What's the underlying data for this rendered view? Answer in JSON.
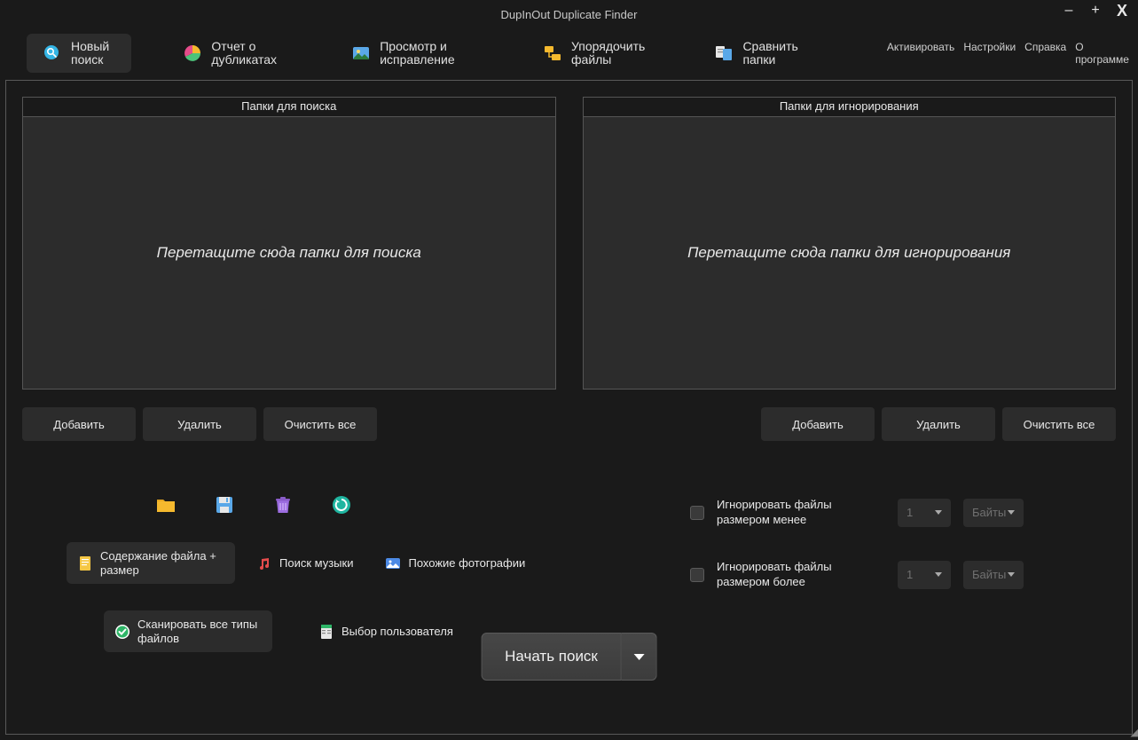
{
  "window": {
    "title": "DupInOut Duplicate Finder",
    "minimize": "–",
    "maximize": "+",
    "close": "X"
  },
  "tabs": {
    "new_search": "Новый поиск",
    "report": "Отчет о дубликатах",
    "review": "Просмотр и исправление",
    "organize": "Упорядочить файлы",
    "compare": "Сравнить папки"
  },
  "menu": {
    "activate": "Активировать",
    "settings": "Настройки",
    "help": "Справка",
    "about": "О программе"
  },
  "panels": {
    "search_title": "Папки для поиска",
    "search_placeholder": "Перетащите сюда папки для поиска",
    "ignore_title": "Папки для игнорирования",
    "ignore_placeholder": "Перетащите сюда папки для игнорирования"
  },
  "buttons": {
    "add": "Добавить",
    "delete": "Удалить",
    "clear": "Очистить все"
  },
  "modes": {
    "content_size": "Содержание файла + размер",
    "music": "Поиск музыки",
    "photos": "Похожие фотографии",
    "all_types": "Сканировать все типы файлов",
    "user_select": "Выбор пользователя"
  },
  "filters": {
    "less_label": "Игнорировать файлы размером менее",
    "more_label": "Игнорировать файлы размером более",
    "value": "1",
    "unit": "Байты"
  },
  "start": {
    "label": "Начать поиск"
  }
}
